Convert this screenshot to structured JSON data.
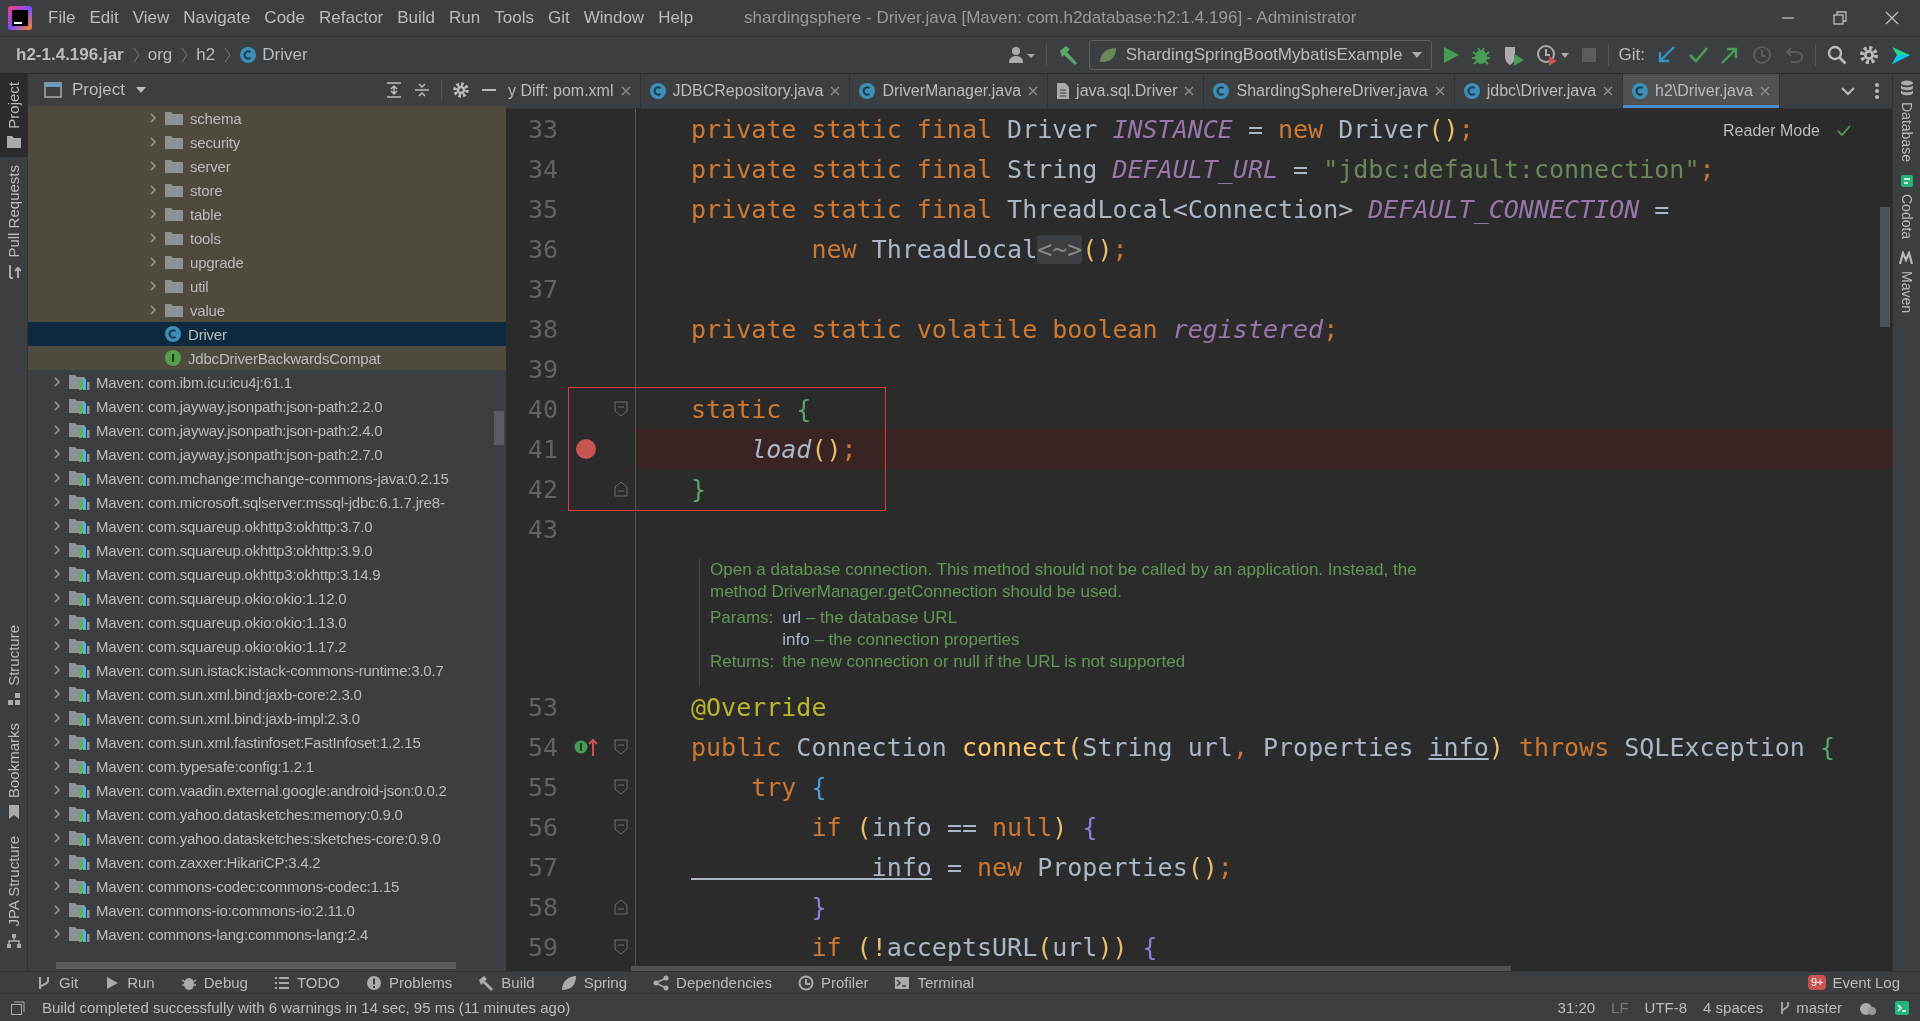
{
  "menu": [
    "File",
    "Edit",
    "View",
    "Navigate",
    "Code",
    "Refactor",
    "Build",
    "Run",
    "Tools",
    "Git",
    "Window",
    "Help"
  ],
  "window_title": "shardingsphere - Driver.java [Maven: com.h2database:h2:1.4.196] - Administrator",
  "breadcrumb": [
    {
      "label": "h2-1.4.196.jar",
      "kind": "jar"
    },
    {
      "label": "org",
      "kind": "package"
    },
    {
      "label": "h2",
      "kind": "package"
    },
    {
      "label": "Driver",
      "kind": "class"
    }
  ],
  "toolbar": {
    "run_config": "ShardingSpringBootMybatisExample",
    "git_label": "Git:"
  },
  "left_stripe_top": [
    {
      "label": "Project",
      "selected": true
    },
    {
      "label": "Pull Requests",
      "selected": false
    }
  ],
  "left_stripe_bottom": [
    {
      "label": "Structure",
      "selected": false
    },
    {
      "label": "Bookmarks",
      "selected": false
    },
    {
      "label": "JPA Structure",
      "selected": false
    }
  ],
  "project_panel": {
    "title": "Project",
    "package_items": [
      {
        "label": "schema",
        "kind": "folder",
        "selected": false
      },
      {
        "label": "security",
        "kind": "folder",
        "selected": false
      },
      {
        "label": "server",
        "kind": "folder",
        "selected": false
      },
      {
        "label": "store",
        "kind": "folder",
        "selected": false
      },
      {
        "label": "table",
        "kind": "folder",
        "selected": false
      },
      {
        "label": "tools",
        "kind": "folder",
        "selected": false
      },
      {
        "label": "upgrade",
        "kind": "folder",
        "selected": false
      },
      {
        "label": "util",
        "kind": "folder",
        "selected": false
      },
      {
        "label": "value",
        "kind": "folder",
        "selected": false
      },
      {
        "label": "Driver",
        "kind": "class",
        "selected": true
      },
      {
        "label": "JdbcDriverBackwardsCompat",
        "kind": "interface",
        "selected": false
      }
    ],
    "library_items": [
      "Maven: com.ibm.icu:icu4j:61.1",
      "Maven: com.jayway.jsonpath:json-path:2.2.0",
      "Maven: com.jayway.jsonpath:json-path:2.4.0",
      "Maven: com.jayway.jsonpath:json-path:2.7.0",
      "Maven: com.mchange:mchange-commons-java:0.2.15",
      "Maven: com.microsoft.sqlserver:mssql-jdbc:6.1.7.jre8-",
      "Maven: com.squareup.okhttp3:okhttp:3.7.0",
      "Maven: com.squareup.okhttp3:okhttp:3.9.0",
      "Maven: com.squareup.okhttp3:okhttp:3.14.9",
      "Maven: com.squareup.okio:okio:1.12.0",
      "Maven: com.squareup.okio:okio:1.13.0",
      "Maven: com.squareup.okio:okio:1.17.2",
      "Maven: com.sun.istack:istack-commons-runtime:3.0.7",
      "Maven: com.sun.xml.bind:jaxb-core:2.3.0",
      "Maven: com.sun.xml.bind:jaxb-impl:2.3.0",
      "Maven: com.sun.xml.fastinfoset:FastInfoset:1.2.15",
      "Maven: com.typesafe:config:1.2.1",
      "Maven: com.vaadin.external.google:android-json:0.0.2",
      "Maven: com.yahoo.datasketches:memory:0.9.0",
      "Maven: com.yahoo.datasketches:sketches-core:0.9.0",
      "Maven: com.zaxxer:HikariCP:3.4.2",
      "Maven: commons-codec:commons-codec:1.15",
      "Maven: commons-io:commons-io:2.11.0",
      "Maven: commons-lang:commons-lang:2.4"
    ]
  },
  "editor": {
    "tabs": [
      {
        "label": "y Diff: pom.xml",
        "kind": "diff",
        "selected": false
      },
      {
        "label": "JDBCRepository.java",
        "kind": "class",
        "selected": false
      },
      {
        "label": "DriverManager.java",
        "kind": "class",
        "selected": false
      },
      {
        "label": "java.sql.Driver",
        "kind": "file",
        "selected": false
      },
      {
        "label": "ShardingSphereDriver.java",
        "kind": "class",
        "selected": false
      },
      {
        "label": "jdbc\\Driver.java",
        "kind": "class",
        "selected": false
      },
      {
        "label": "h2\\Driver.java",
        "kind": "class",
        "selected": true
      }
    ],
    "reader_mode": "Reader Mode",
    "lines": [
      {
        "number": "33",
        "breakpoint": false,
        "implements": false,
        "fold_start": false,
        "fold_end": false,
        "framed": false,
        "tokens": [
          {
            "kind": "kw",
            "text": "private static final "
          },
          {
            "kind": "type",
            "text": "Driver "
          },
          {
            "kind": "field",
            "text": "INSTANCE"
          },
          {
            "kind": "plain",
            "text": " = "
          },
          {
            "kind": "kw",
            "text": "new "
          },
          {
            "kind": "type",
            "text": "Driver"
          },
          {
            "kind": "paren",
            "text": "()"
          },
          {
            "kind": "kw",
            "text": ";"
          }
        ]
      },
      {
        "number": "34",
        "breakpoint": false,
        "implements": false,
        "fold_start": false,
        "fold_end": false,
        "framed": false,
        "tokens": [
          {
            "kind": "kw",
            "text": "private static final "
          },
          {
            "kind": "type",
            "text": "String "
          },
          {
            "kind": "field",
            "text": "DEFAULT_URL"
          },
          {
            "kind": "plain",
            "text": " = "
          },
          {
            "kind": "str",
            "text": "\"jdbc:default:connection\""
          },
          {
            "kind": "kw",
            "text": ";"
          }
        ]
      },
      {
        "number": "35",
        "breakpoint": false,
        "implements": false,
        "fold_start": false,
        "fold_end": false,
        "framed": false,
        "tokens": [
          {
            "kind": "kw",
            "text": "private static final "
          },
          {
            "kind": "type",
            "text": "ThreadLocal<Connection> "
          },
          {
            "kind": "field",
            "text": "DEFAULT_CONNECTION"
          },
          {
            "kind": "plain",
            "text": " ="
          }
        ]
      },
      {
        "number": "36",
        "breakpoint": false,
        "implements": false,
        "fold_start": false,
        "fold_end": false,
        "framed": false,
        "tokens": [
          {
            "kind": "kw",
            "text": "        new "
          },
          {
            "kind": "type",
            "text": "ThreadLocal"
          },
          {
            "kind": "inlay",
            "text": "<~>"
          },
          {
            "kind": "paren",
            "text": "()"
          },
          {
            "kind": "kw",
            "text": ";"
          }
        ]
      },
      {
        "number": "37",
        "breakpoint": false,
        "implements": false,
        "fold_start": false,
        "fold_end": false,
        "framed": false
      },
      {
        "number": "38",
        "breakpoint": false,
        "implements": false,
        "fold_start": false,
        "fold_end": false,
        "framed": false,
        "tokens": [
          {
            "kind": "kw",
            "text": "private static volatile boolean "
          },
          {
            "kind": "field",
            "text": "registered"
          },
          {
            "kind": "kw",
            "text": ";"
          }
        ]
      },
      {
        "number": "39",
        "breakpoint": false,
        "implements": false,
        "fold_start": false,
        "fold_end": false,
        "framed": false
      },
      {
        "number": "40",
        "breakpoint": false,
        "implements": false,
        "fold_start": true,
        "fold_end": false,
        "framed": true,
        "tokens": [
          {
            "kind": "kw",
            "text": "static "
          },
          {
            "kind": "brace-green",
            "text": "{"
          }
        ]
      },
      {
        "number": "41",
        "breakpoint": true,
        "implements": false,
        "fold_start": false,
        "fold_end": false,
        "framed": true,
        "tokens": [
          {
            "kind": "call",
            "text": "    load"
          },
          {
            "kind": "paren",
            "text": "()"
          },
          {
            "kind": "kw",
            "text": ";"
          }
        ]
      },
      {
        "number": "42",
        "breakpoint": false,
        "implements": false,
        "fold_start": false,
        "fold_end": true,
        "framed": true,
        "tokens": [
          {
            "kind": "brace-green",
            "text": "}"
          }
        ]
      },
      {
        "number": "43",
        "breakpoint": false,
        "implements": false,
        "fold_start": false,
        "fold_end": false,
        "framed": false
      },
      {
        "kind": "javadoc",
        "description": "Open a database connection. This method should not be called by an application. Instead, the method DriverManager.getConnection should be used.",
        "params_label": "Params:",
        "params": [
          {
            "name": "url",
            "text": "– the database URL"
          },
          {
            "name": "info",
            "text": "– the connection properties"
          }
        ],
        "returns_label": "Returns:",
        "returns": "the new connection or null if the URL is not supported"
      },
      {
        "number": "53",
        "breakpoint": false,
        "implements": false,
        "fold_start": false,
        "fold_end": false,
        "framed": false,
        "tokens": [
          {
            "kind": "annot",
            "text": "@Override"
          }
        ]
      },
      {
        "number": "54",
        "breakpoint": false,
        "implements": true,
        "fold_start": true,
        "fold_end": false,
        "framed": false,
        "tokens": [
          {
            "kind": "kw",
            "text": "public "
          },
          {
            "kind": "type",
            "text": "Connection "
          },
          {
            "kind": "method",
            "text": "connect"
          },
          {
            "kind": "paren",
            "text": "("
          },
          {
            "kind": "type",
            "text": "String "
          },
          {
            "kind": "plain",
            "text": "url"
          },
          {
            "kind": "kw",
            "text": ", "
          },
          {
            "kind": "type",
            "text": "Properties "
          },
          {
            "kind": "param",
            "text": "info"
          },
          {
            "kind": "paren",
            "text": ") "
          },
          {
            "kind": "kw",
            "text": "throws "
          },
          {
            "kind": "type",
            "text": "SQLException "
          },
          {
            "kind": "brace-green",
            "text": "{"
          }
        ]
      },
      {
        "number": "55",
        "breakpoint": false,
        "implements": false,
        "fold_start": true,
        "fold_end": false,
        "framed": false,
        "tokens": [
          {
            "kind": "kw",
            "text": "    try "
          },
          {
            "kind": "brace-blue",
            "text": "{"
          }
        ]
      },
      {
        "number": "56",
        "breakpoint": false,
        "implements": false,
        "fold_start": true,
        "fold_end": false,
        "framed": false,
        "tokens": [
          {
            "kind": "kw",
            "text": "        if "
          },
          {
            "kind": "paren",
            "text": "("
          },
          {
            "kind": "plain",
            "text": "info == "
          },
          {
            "kind": "kw",
            "text": "null"
          },
          {
            "kind": "paren",
            "text": ") "
          },
          {
            "kind": "brace-purple",
            "text": "{"
          }
        ]
      },
      {
        "number": "57",
        "breakpoint": false,
        "implements": false,
        "fold_start": false,
        "fold_end": false,
        "framed": false,
        "tokens": [
          {
            "kind": "param",
            "text": "            info"
          },
          {
            "kind": "plain",
            "text": " = "
          },
          {
            "kind": "kw",
            "text": "new "
          },
          {
            "kind": "type",
            "text": "Properties"
          },
          {
            "kind": "paren",
            "text": "()"
          },
          {
            "kind": "kw",
            "text": ";"
          }
        ]
      },
      {
        "number": "58",
        "breakpoint": false,
        "implements": false,
        "fold_start": false,
        "fold_end": true,
        "framed": false,
        "tokens": [
          {
            "kind": "brace-purple",
            "text": "        }"
          }
        ]
      },
      {
        "number": "59",
        "breakpoint": false,
        "implements": false,
        "fold_start": true,
        "fold_end": false,
        "framed": false,
        "tokens": [
          {
            "kind": "kw",
            "text": "        if "
          },
          {
            "kind": "paren",
            "text": "(!"
          },
          {
            "kind": "plain",
            "text": "acceptsURL"
          },
          {
            "kind": "paren",
            "text": "("
          },
          {
            "kind": "plain",
            "text": "url"
          },
          {
            "kind": "paren",
            "text": ")) "
          },
          {
            "kind": "brace-purple",
            "text": "{"
          }
        ]
      }
    ]
  },
  "right_stripe": [
    "Database",
    "Codota",
    "Maven"
  ],
  "tool_windows": [
    {
      "label": "Git",
      "kind": "git"
    },
    {
      "label": "Run",
      "kind": "run"
    },
    {
      "label": "Debug",
      "kind": "debug"
    },
    {
      "label": "TODO",
      "kind": "todo"
    },
    {
      "label": "Problems",
      "kind": "problems"
    },
    {
      "label": "Build",
      "kind": "build"
    },
    {
      "label": "Spring",
      "kind": "spring"
    },
    {
      "label": "Dependencies",
      "kind": "dependencies"
    },
    {
      "label": "Profiler",
      "kind": "profiler"
    },
    {
      "label": "Terminal",
      "kind": "terminal"
    }
  ],
  "event_log": {
    "label": "Event Log",
    "badge": "9+"
  },
  "status_bar": {
    "message": "Build completed successfully with 6 warnings in 14 sec, 95 ms (11 minutes ago)",
    "position": "31:20",
    "line_separator": "LF",
    "encoding": "UTF-8",
    "indent": "4 spaces",
    "branch": "master"
  }
}
